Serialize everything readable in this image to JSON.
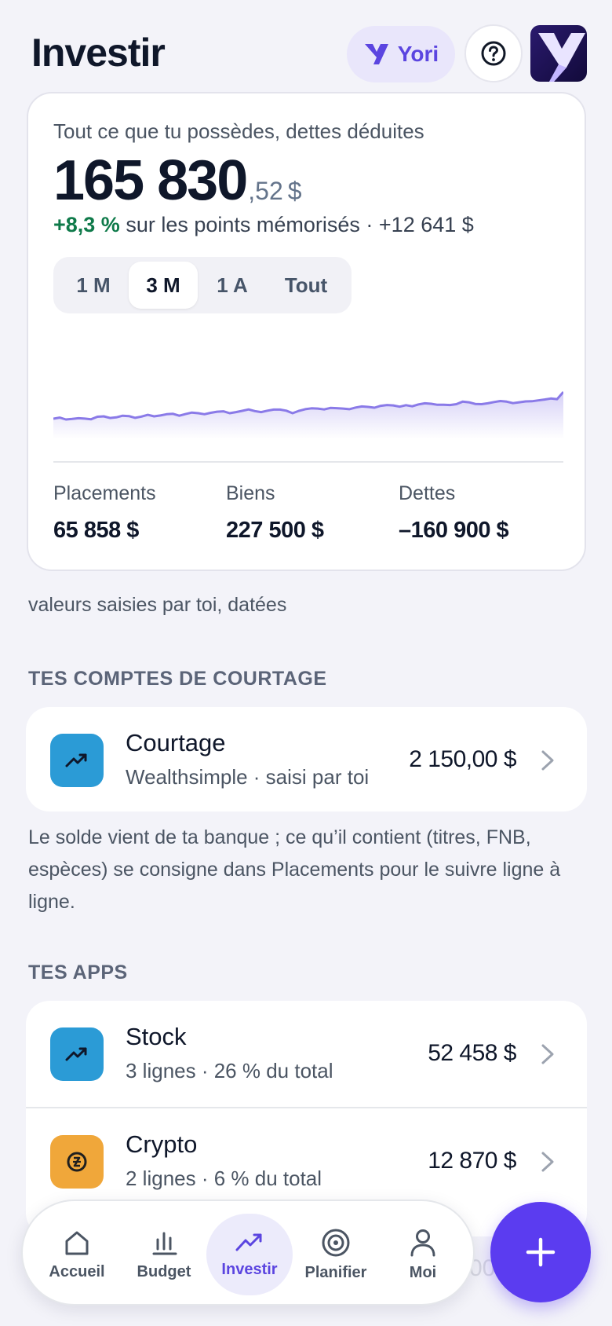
{
  "header": {
    "title": "Investir",
    "assistant_label": "Yori"
  },
  "networth": {
    "label": "Tout ce que tu possèdes, dettes déduites",
    "amount_int": "165 830",
    "amount_dec": ",52",
    "currency": "$",
    "change_pct": "+8,3 %",
    "change_text": " sur les points mémorisés · ",
    "change_amount": "+12 641 $",
    "ranges": [
      {
        "label": "1 M",
        "active": false
      },
      {
        "label": "3 M",
        "active": true
      },
      {
        "label": "1 A",
        "active": false
      },
      {
        "label": "Tout",
        "active": false
      }
    ],
    "stats": [
      {
        "label": "Placements",
        "value": "65 858 $"
      },
      {
        "label": "Biens",
        "value": "227 500 $"
      },
      {
        "label": "Dettes",
        "value": "–160 900 $"
      }
    ]
  },
  "chart_data": {
    "type": "area",
    "series": [
      {
        "values": [
          0.46,
          1.0,
          0.1,
          0.35,
          0.7,
          0.5,
          0.2,
          1.4,
          1.6,
          0.8,
          1.1,
          1.9,
          1.7,
          0.9,
          1.5,
          2.3,
          1.6,
          2.0,
          2.6,
          2.8,
          1.9,
          2.7,
          3.4,
          3.1,
          2.6,
          3.3,
          3.8,
          4.0,
          3.1,
          3.6,
          4.2,
          4.9,
          4.1,
          3.6,
          4.3,
          4.8,
          4.8,
          4.3,
          3.1,
          4.2,
          5.0,
          5.4,
          5.3,
          4.9,
          5.6,
          5.5,
          5.3,
          5.0,
          5.8,
          6.3,
          6.1,
          5.7,
          6.6,
          7.0,
          6.8,
          6.2,
          6.9,
          6.4,
          7.3,
          7.8,
          7.6,
          7.1,
          7.1,
          7.0,
          7.4,
          8.6,
          8.3,
          7.5,
          7.4,
          7.8,
          8.4,
          8.9,
          8.6,
          7.9,
          8.3,
          8.7,
          8.8,
          9.2,
          9.6,
          10.1,
          9.8,
          13.2
        ]
      }
    ]
  },
  "note": "valeurs saisies par toi, datées",
  "brokerage": {
    "section_title": "TES COMPTES DE COURTAGE",
    "rows": [
      {
        "title": "Courtage",
        "subtitle": "Wealthsimple · saisi par toi",
        "value": "2 150,00 $",
        "icon": "trending-up-icon",
        "color": "#2b9bd6"
      }
    ],
    "explanation": "Le solde vient de ta banque ; ce qu’il contient (titres, FNB, espèces) se consigne dans Placements pour le suivre ligne à ligne."
  },
  "apps": {
    "section_title": "TES APPS",
    "rows": [
      {
        "title": "Stock",
        "subtitle": "3 lignes · 26 % du total",
        "value": "52 458 $",
        "icon": "trending-up-icon",
        "color": "#2b9bd6"
      },
      {
        "title": "Crypto",
        "subtitle": "2 lignes · 6 % du total",
        "value": "12 870 $",
        "icon": "coin-icon",
        "color": "#f0a73a"
      }
    ]
  },
  "nav": {
    "items": [
      {
        "label": "Accueil",
        "icon": "home-icon",
        "active": false
      },
      {
        "label": "Budget",
        "icon": "bar-chart-icon",
        "active": false
      },
      {
        "label": "Investir",
        "icon": "trending-up-icon",
        "active": true
      },
      {
        "label": "Planifier",
        "icon": "target-icon",
        "active": false
      },
      {
        "label": "Moi",
        "icon": "user-icon",
        "active": false
      }
    ],
    "ghost_text": "00"
  },
  "colors": {
    "accent": "#5b3cf0",
    "positive": "#0f7a4a",
    "chart_line": "#8a7ae8"
  }
}
